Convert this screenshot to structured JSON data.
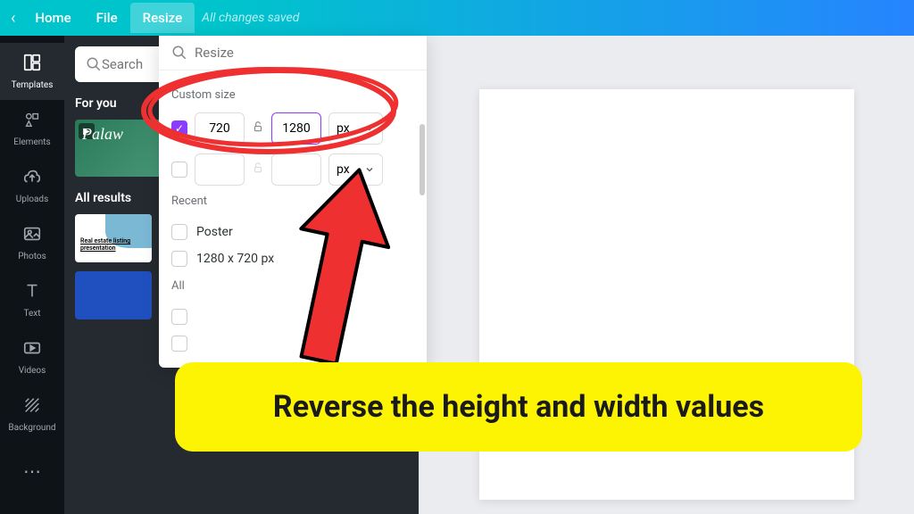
{
  "topbar": {
    "home": "Home",
    "file": "File",
    "resize": "Resize",
    "saved": "All changes saved"
  },
  "sidebar": {
    "items": [
      {
        "label": "Templates",
        "icon": "templates"
      },
      {
        "label": "Elements",
        "icon": "elements"
      },
      {
        "label": "Uploads",
        "icon": "uploads"
      },
      {
        "label": "Photos",
        "icon": "photos"
      },
      {
        "label": "Text",
        "icon": "text"
      },
      {
        "label": "Videos",
        "icon": "videos"
      },
      {
        "label": "Background",
        "icon": "background"
      }
    ]
  },
  "panel": {
    "search_placeholder": "Search",
    "for_you": "For you",
    "all_results": "All results",
    "thumb2_text": "Real estate listing presentation"
  },
  "resize": {
    "search_placeholder": "Resize",
    "custom_size_label": "Custom size",
    "width": "720",
    "height": "1280",
    "unit": "px",
    "recent_label": "Recent",
    "recent_items": [
      "Poster",
      "1280 x 720 px"
    ],
    "all_label": "All"
  },
  "annotation": {
    "text": "Reverse the height and width values"
  },
  "colors": {
    "accent": "#8b3dff",
    "annotation_red": "#ee3030",
    "annotation_yellow": "#fcf403"
  }
}
